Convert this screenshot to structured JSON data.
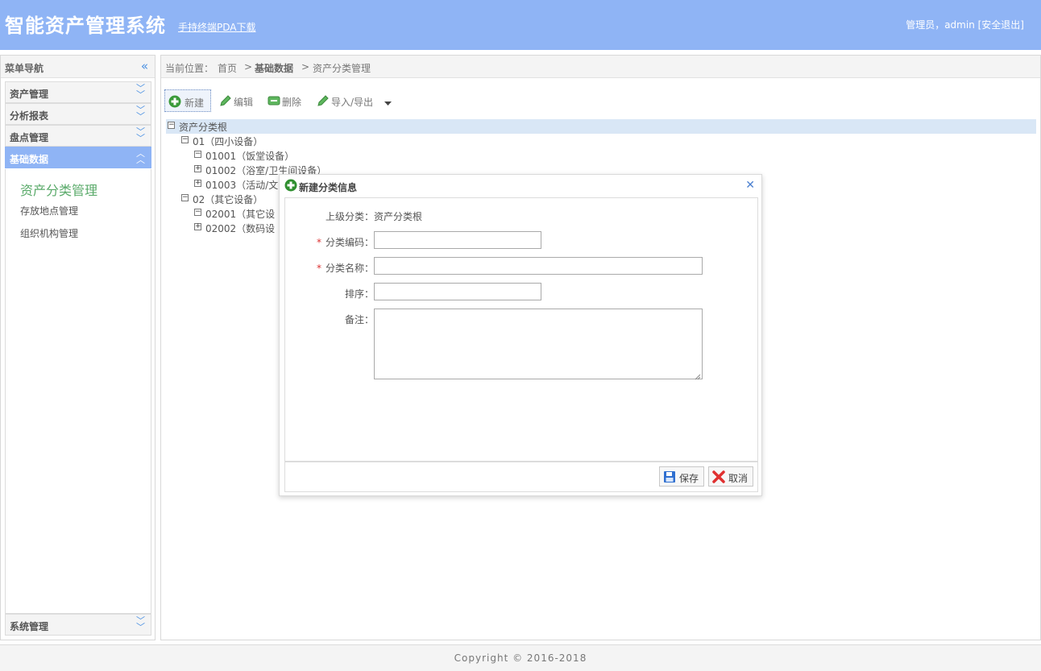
{
  "header": {
    "title": "智能资产管理系统",
    "pda_link": "手持终端PDA下载",
    "user_text": "管理员，admin ",
    "logout": "[安全退出]"
  },
  "sidebar": {
    "title": "菜单导航",
    "groups": [
      {
        "label": "资产管理"
      },
      {
        "label": "分析报表"
      },
      {
        "label": "盘点管理"
      },
      {
        "label": "基础数据",
        "active": true
      }
    ],
    "items": [
      {
        "label": "资产分类管理",
        "current": true
      },
      {
        "label": "存放地点管理"
      },
      {
        "label": "组织机构管理"
      }
    ],
    "bottom_group": {
      "label": "系统管理"
    }
  },
  "breadcrumb": {
    "prefix": "当前位置：",
    "home": "首页",
    "sep1": ">",
    "section": "基础数据",
    "sep2": ">",
    "page": "资产分类管理"
  },
  "toolbar": {
    "new": "新建",
    "edit": "编辑",
    "delete": "删除",
    "import_export": "导入/导出"
  },
  "tree": {
    "root": "资产分类根",
    "nodes": [
      {
        "label": "01（四小设备）",
        "expanded": true
      },
      {
        "label": "01001（饭堂设备）",
        "expanded": true
      },
      {
        "label": "01002（浴室/卫生间设备）",
        "expanded": false
      },
      {
        "label": "01003（活动/文",
        "expanded": false
      },
      {
        "label": "02（其它设备）",
        "expanded": true
      },
      {
        "label": "02001（其它设",
        "expanded": true
      },
      {
        "label": "02002（数码设",
        "expanded": false
      }
    ]
  },
  "dialog": {
    "title": "新建分类信息",
    "parent_label": "上级分类：",
    "parent_value": "资产分类根",
    "code_label": "分类编码：",
    "name_label": "分类名称：",
    "order_label": "排序：",
    "remark_label": "备注：",
    "required_mark": "*",
    "code_value": "",
    "name_value": "",
    "order_value": "",
    "remark_value": "",
    "save": "保存",
    "cancel": "取消"
  },
  "footer": {
    "copyright": "Copyright © 2016-2018"
  },
  "colors": {
    "header_bg": "#8fb4f5",
    "active_group_bg": "#8fb4f5",
    "current_item": "#5aaa6a",
    "selected_row": "#d9e7f6"
  }
}
